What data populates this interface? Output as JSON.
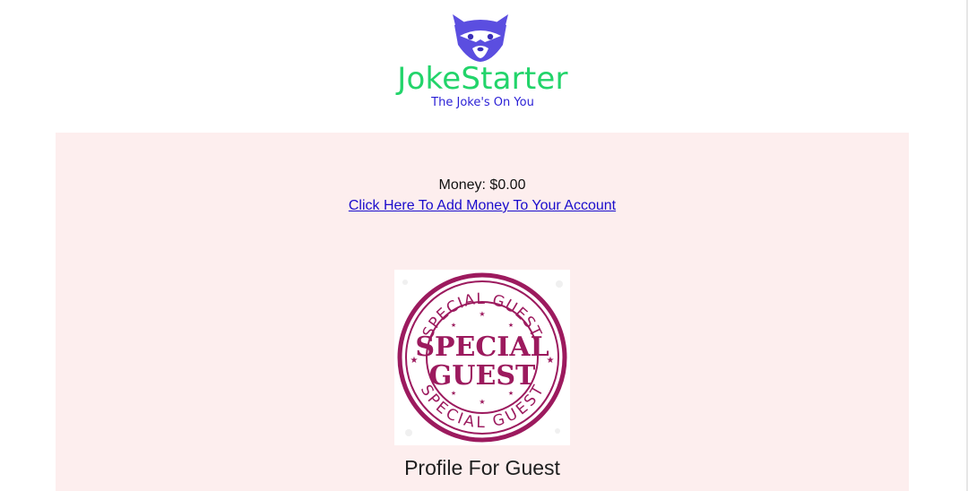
{
  "brand": {
    "name": "JokeStarter",
    "tagline": "The Joke's On You",
    "logo_icon": "raccoon-icon",
    "name_color": "#22d46a",
    "tagline_color": "#2a1fd6",
    "logo_color": "#5b4ee0"
  },
  "account": {
    "money_text": "Money: $0.00",
    "add_money_link": "Click Here To Add Money To Your Account"
  },
  "profile": {
    "image_icon": "special-guest-stamp",
    "stamp_text_top": "SPECIAL GUEST",
    "stamp_text_center_line1": "SPECIAL",
    "stamp_text_center_line2": "GUEST",
    "stamp_text_bottom": "SPECIAL GUEST",
    "stamp_color": "#9c1a5e",
    "title": "Profile For Guest"
  },
  "colors": {
    "panel_background": "#fdeeee",
    "link": "#1a0dcc"
  }
}
